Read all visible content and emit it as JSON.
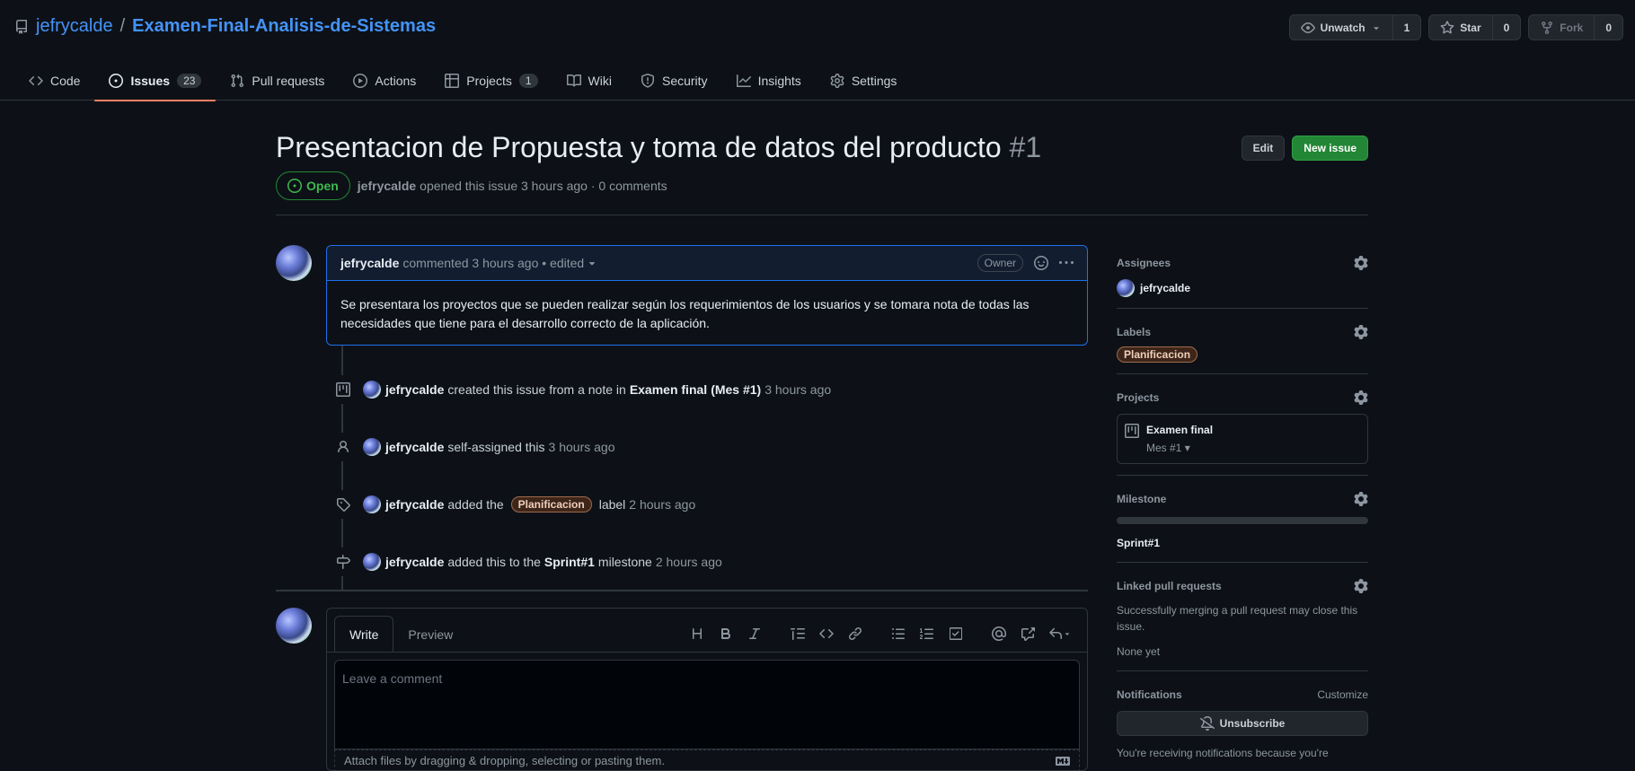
{
  "repo": {
    "owner": "jefrycalde",
    "separator": "/",
    "name": "Examen-Final-Analisis-de-Sistemas"
  },
  "repo_actions": {
    "watch": {
      "label": "Unwatch",
      "count": "1"
    },
    "star": {
      "label": "Star",
      "count": "0"
    },
    "fork": {
      "label": "Fork",
      "count": "0"
    }
  },
  "tabs": [
    {
      "label": "Code",
      "icon": "code-icon"
    },
    {
      "label": "Issues",
      "icon": "issue-opened-icon",
      "count": "23",
      "active": true
    },
    {
      "label": "Pull requests",
      "icon": "git-pull-request-icon"
    },
    {
      "label": "Actions",
      "icon": "play-icon"
    },
    {
      "label": "Projects",
      "icon": "table-icon",
      "count": "1"
    },
    {
      "label": "Wiki",
      "icon": "book-icon"
    },
    {
      "label": "Security",
      "icon": "shield-icon"
    },
    {
      "label": "Insights",
      "icon": "graph-icon"
    },
    {
      "label": "Settings",
      "icon": "gear-icon"
    }
  ],
  "issue": {
    "title": "Presentacion de Propuesta y toma de datos del producto",
    "number": "#1",
    "edit_label": "Edit",
    "new_issue_label": "New issue",
    "state": "Open",
    "author": "jefrycalde",
    "opened_text": "opened this issue 3 hours ago · 0 comments"
  },
  "comment": {
    "author": "jefrycalde",
    "meta": "commented 3 hours ago • edited",
    "role": "Owner",
    "body": "Se presentara los proyectos que se pueden realizar según los requerimientos de los usuarios y se tomara nota de todas las necesidades que tiene para el desarrollo correcto de la aplicación."
  },
  "timeline": {
    "created": {
      "user": "jefrycalde",
      "text": "created this issue from a note in",
      "project": "Examen final",
      "column": "(Mes #1)",
      "time": "3 hours ago"
    },
    "assigned": {
      "user": "jefrycalde",
      "text": "self-assigned this",
      "time": "3 hours ago"
    },
    "labeled": {
      "user": "jefrycalde",
      "text_before": "added the",
      "label": "Planificacion",
      "text_after": "label",
      "time": "2 hours ago"
    },
    "milestone": {
      "user": "jefrycalde",
      "text_before": "added this to the",
      "milestone": "Sprint#1",
      "text_after": "milestone",
      "time": "2 hours ago"
    }
  },
  "composer": {
    "write_tab": "Write",
    "preview_tab": "Preview",
    "placeholder": "Leave a comment",
    "attach_text": "Attach files by dragging & dropping, selecting or pasting them."
  },
  "sidebar": {
    "assignees": {
      "heading": "Assignees",
      "value": "jefrycalde"
    },
    "labels": {
      "heading": "Labels",
      "value": "Planificacion"
    },
    "projects": {
      "heading": "Projects",
      "name": "Examen final",
      "column": "Mes #1"
    },
    "milestone": {
      "heading": "Milestone",
      "value": "Sprint#1",
      "progress": 0
    },
    "linked_prs": {
      "heading": "Linked pull requests",
      "description": "Successfully merging a pull request may close this issue.",
      "value": "None yet"
    },
    "notifications": {
      "heading": "Notifications",
      "customize": "Customize",
      "button": "Unsubscribe",
      "note": "You're receiving notifications because you're"
    }
  },
  "colors": {
    "accent": "#4493f8",
    "open": "#3fb950",
    "tab_underline": "#f78166",
    "label_bg": "#3d2619"
  }
}
